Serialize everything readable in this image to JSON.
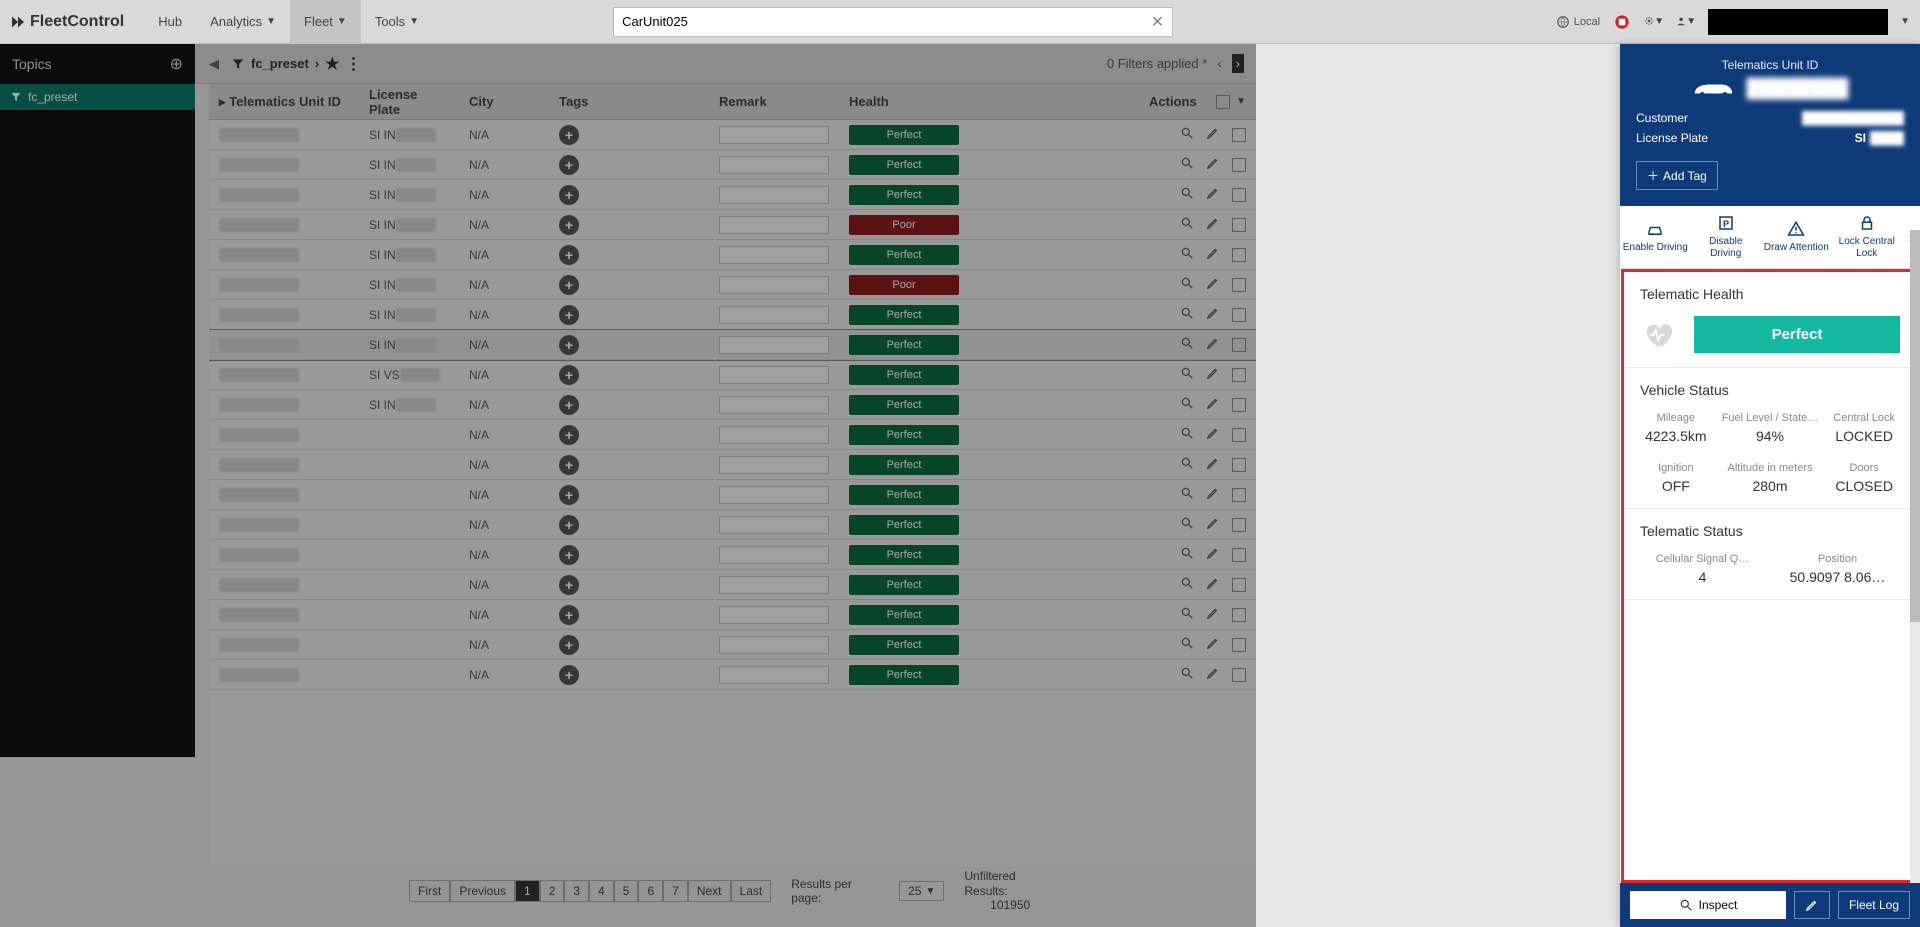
{
  "app_name": "FleetControl",
  "nav": {
    "hub": "Hub",
    "analytics": "Analytics",
    "fleet": "Fleet",
    "tools": "Tools"
  },
  "search": {
    "value": "CarUnit025"
  },
  "env": "Local",
  "sidebar": {
    "title": "Topics",
    "preset": "fc_preset"
  },
  "preset_bar": {
    "name": "fc_preset",
    "filters": "0 Filters applied *"
  },
  "columns": {
    "id": "Telematics Unit ID",
    "lp": "License Plate",
    "city": "City",
    "tags": "Tags",
    "remark": "Remark",
    "health": "Health",
    "actions": "Actions"
  },
  "rows": [
    {
      "lp": "SI IN",
      "city": "N/A",
      "health": "Perfect"
    },
    {
      "lp": "SI IN",
      "city": "N/A",
      "health": "Perfect"
    },
    {
      "lp": "SI IN",
      "city": "N/A",
      "health": "Perfect"
    },
    {
      "lp": "SI IN",
      "city": "N/A",
      "health": "Poor"
    },
    {
      "lp": "SI IN",
      "city": "N/A",
      "health": "Perfect"
    },
    {
      "lp": "SI IN",
      "city": "N/A",
      "health": "Poor"
    },
    {
      "lp": "SI IN",
      "city": "N/A",
      "health": "Perfect"
    },
    {
      "lp": "SI IN",
      "city": "N/A",
      "health": "Perfect",
      "selected": true
    },
    {
      "lp": "SI VS",
      "city": "N/A",
      "health": "Perfect"
    },
    {
      "lp": "SI IN",
      "city": "N/A",
      "health": "Perfect"
    },
    {
      "lp": "",
      "city": "N/A",
      "health": "Perfect"
    },
    {
      "lp": "",
      "city": "N/A",
      "health": "Perfect"
    },
    {
      "lp": "",
      "city": "N/A",
      "health": "Perfect"
    },
    {
      "lp": "",
      "city": "N/A",
      "health": "Perfect"
    },
    {
      "lp": "",
      "city": "N/A",
      "health": "Perfect"
    },
    {
      "lp": "",
      "city": "N/A",
      "health": "Perfect"
    },
    {
      "lp": "",
      "city": "N/A",
      "health": "Perfect"
    },
    {
      "lp": "",
      "city": "N/A",
      "health": "Perfect"
    },
    {
      "lp": "",
      "city": "N/A",
      "health": "Perfect"
    }
  ],
  "pager": {
    "first": "First",
    "prev": "Previous",
    "pages": [
      "1",
      "2",
      "3",
      "4",
      "5",
      "6",
      "7"
    ],
    "next": "Next",
    "last": "Last",
    "per_label": "Results per page:",
    "per_value": "25",
    "unf_label": "Unfiltered Results:",
    "unf_value": "101950"
  },
  "detail": {
    "title": "Telematics Unit ID",
    "customer_label": "Customer",
    "lp_label": "License Plate",
    "lp_prefix": "SI",
    "add_tag": "Add Tag",
    "actions": {
      "enable": "Enable Driving",
      "disable": "Disable Driving",
      "draw": "Draw Attention",
      "lock": "Lock Central Lock"
    },
    "health": {
      "title": "Telematic Health",
      "value": "Perfect"
    },
    "vehicle": {
      "title": "Vehicle Status",
      "mileage": {
        "label": "Mileage",
        "value": "4223.5km"
      },
      "fuel": {
        "label": "Fuel Level / State…",
        "value": "94%"
      },
      "clock": {
        "label": "Central Lock",
        "value": "LOCKED"
      },
      "ign": {
        "label": "Ignition",
        "value": "OFF"
      },
      "alt": {
        "label": "Altitude in meters",
        "value": "280m"
      },
      "doors": {
        "label": "Doors",
        "value": "CLOSED"
      }
    },
    "telem": {
      "title": "Telematic Status",
      "sig": {
        "label": "Cellular Signal Q…",
        "value": "4"
      },
      "pos": {
        "label": "Position",
        "value": "50.9097 8.06…"
      }
    },
    "footer": {
      "inspect": "Inspect",
      "log": "Fleet Log"
    }
  }
}
